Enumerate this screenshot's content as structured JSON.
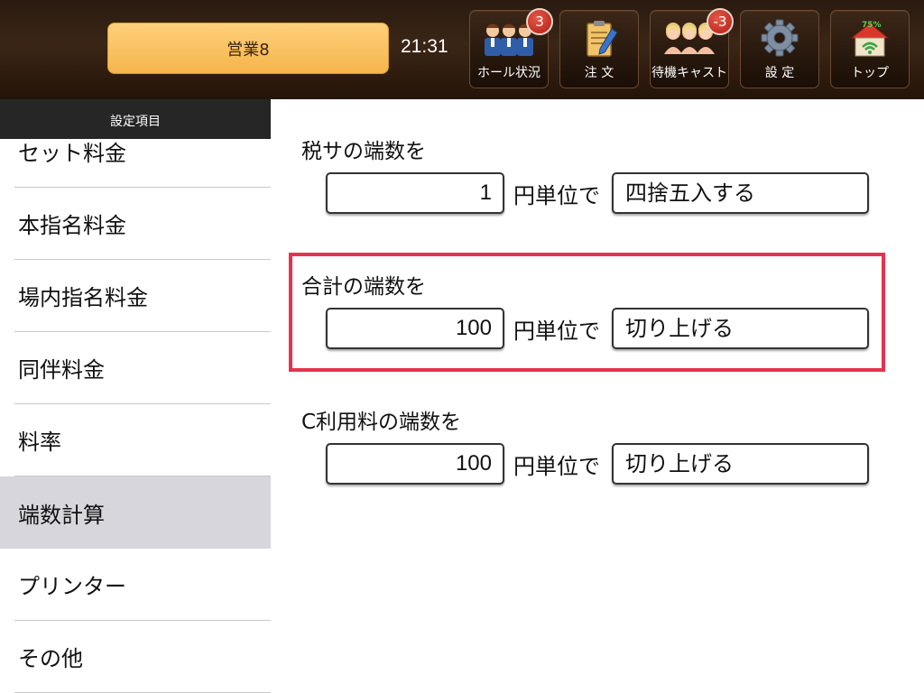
{
  "header": {
    "business_button": "営業8",
    "clock": "21:31",
    "tools": [
      {
        "label": "ホール状況",
        "icon": "staff-group-icon",
        "badge": "3"
      },
      {
        "label": "注 文",
        "icon": "order-notepad-icon"
      },
      {
        "label": "待機キャスト",
        "icon": "waiting-cast-icon",
        "badge": "-3"
      },
      {
        "label": "設 定",
        "icon": "gear-icon"
      },
      {
        "label": "トップ",
        "icon": "home-wifi-icon",
        "indicator": "75%"
      }
    ]
  },
  "sidebar": {
    "title": "設定項目",
    "items": [
      {
        "label": "セット料金"
      },
      {
        "label": "本指名料金"
      },
      {
        "label": "場内指名料金"
      },
      {
        "label": "同伴料金"
      },
      {
        "label": "料率"
      },
      {
        "label": "端数計算",
        "active": true
      },
      {
        "label": "プリンター"
      },
      {
        "label": "その他"
      }
    ]
  },
  "main": {
    "sections": [
      {
        "title": "税サの端数を",
        "unit_value": "1",
        "unit_label": "円単位で",
        "mode": "四捨五入する"
      },
      {
        "title": "合計の端数を",
        "unit_value": "100",
        "unit_label": "円単位で",
        "mode": "切り上げる",
        "highlighted": true
      },
      {
        "title": "C利用料の端数を",
        "unit_value": "100",
        "unit_label": "円単位で",
        "mode": "切り上げる"
      }
    ]
  },
  "colors": {
    "header_bg": "#2e1c10",
    "business_button": "#f7bc55",
    "active_item_bg": "#d6d6dc",
    "highlight_border": "#e4334f",
    "badge": "#c42a1c"
  }
}
